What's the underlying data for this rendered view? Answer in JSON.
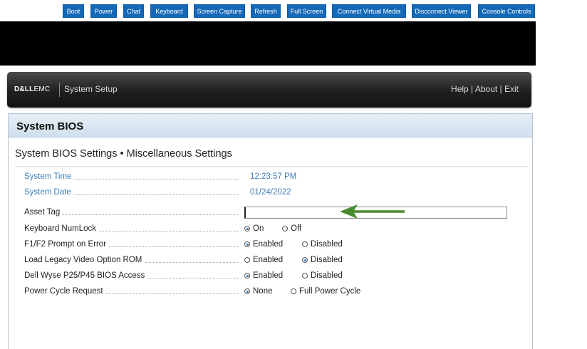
{
  "toolbar": {
    "buttons": [
      "Boot",
      "Power",
      "Chat",
      "Keyboard",
      "Screen Capture",
      "Refresh",
      "Full Screen",
      "Connect Virtual Media",
      "Disconnect Viewer",
      "Console Controls"
    ]
  },
  "header": {
    "logo_dell": "D&LL",
    "logo_emc": "EMC",
    "title": "System Setup",
    "links": "Help | About | Exit"
  },
  "panel": {
    "title": "System BIOS",
    "subtitle": "System BIOS Settings • Miscellaneous Settings"
  },
  "settings": {
    "system_time": {
      "label": "System Time",
      "value": "12:23:57 PM"
    },
    "system_date": {
      "label": "System Date",
      "value": "01/24/2022"
    },
    "asset_tag": {
      "label": "Asset Tag",
      "value": ""
    },
    "numlock": {
      "label": "Keyboard NumLock",
      "options": [
        "On",
        "Off"
      ],
      "selected": "On"
    },
    "f1f2": {
      "label": "F1/F2 Prompt on Error",
      "options": [
        "Enabled",
        "Disabled"
      ],
      "selected": "Enabled"
    },
    "legacy_video": {
      "label": "Load Legacy Video Option ROM",
      "options": [
        "Enabled",
        "Disabled"
      ],
      "selected": "Disabled"
    },
    "wyse": {
      "label": "Dell Wyse P25/P45 BIOS Access",
      "options": [
        "Enabled",
        "Disabled"
      ],
      "selected": "Enabled"
    },
    "power_cycle": {
      "label": "Power Cycle Request",
      "options": [
        "None",
        "Full Power Cycle"
      ],
      "selected": "None"
    }
  },
  "annotation": {
    "arrow_color": "#4a8a2e",
    "icon": "arrow-left-icon"
  },
  "colors": {
    "toolbar_button": "#1469b8",
    "readonly_text": "#3e7bb0",
    "radio_selected": "#2a6fc0"
  }
}
